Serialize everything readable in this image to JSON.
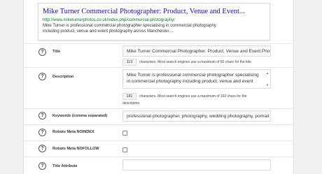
{
  "preview": {
    "title": "Mike Turner Commercial Photographer: Product, Venue and Event...",
    "url": "http://www.miketurnerphotos.co.uk/index.php/commercial-photography/",
    "description": "Mike Turner is professional commercial photographer specialising in commercial photography including product, venue and event photography across Manchester...."
  },
  "fields": {
    "title": {
      "label": "Title",
      "value": "Mike Turner Commercial Photographer: Product, Venue and Event Photo",
      "count": "113",
      "note": "characters. Most search engines use a maximum of 60 chars for the title."
    },
    "description": {
      "label": "Description",
      "value": "Mike Turner is professional commercial photographer specialising in commercial photography including product, venue and event",
      "count": "181",
      "note": "characters. Most search engines use a maximum of 160 chars for the",
      "note_cont": "description."
    },
    "keywords": {
      "label": "Keywords (comma separated)",
      "value": "professional photographer, photography, wedding photography, portrait"
    },
    "noindex": {
      "label": "Robots Meta NOINDEX"
    },
    "nofollow": {
      "label": "Robots Meta NOFOLLOW"
    },
    "title_attribute": {
      "label": "Title Attribute",
      "value": ""
    }
  },
  "help_glyph": "?",
  "icons": [
    "help-icon",
    "checkbox",
    "scroll-up-arrow",
    "scroll-down-arrow"
  ],
  "colors": {
    "link": "#1a0dab",
    "url": "#0b7a2b"
  }
}
